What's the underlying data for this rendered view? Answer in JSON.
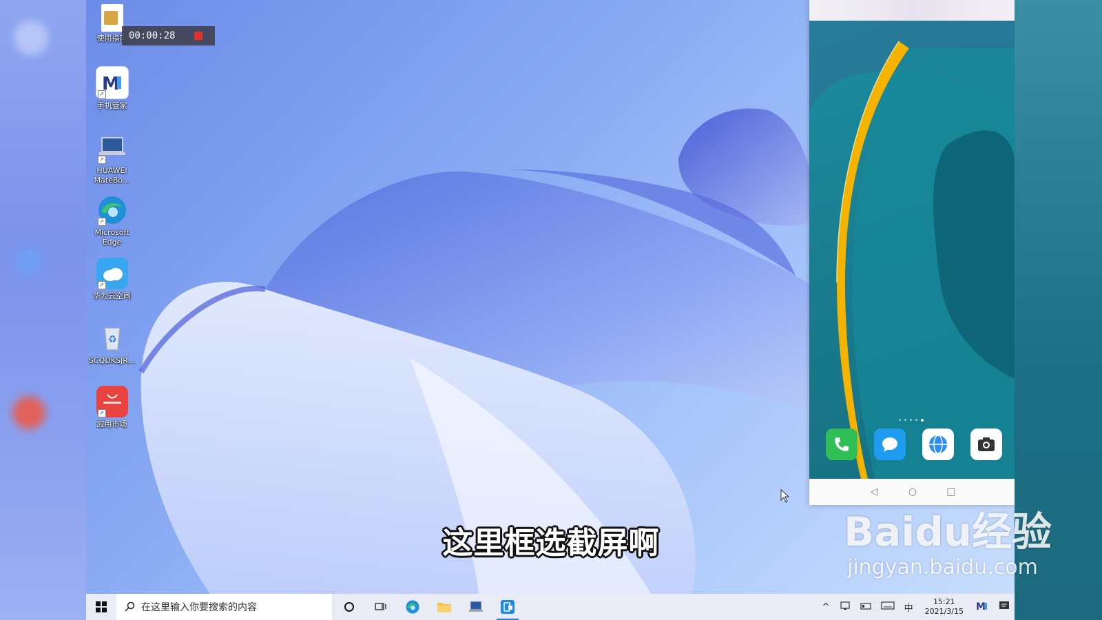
{
  "recorder": {
    "time": "00:00:28"
  },
  "desktop_icons": [
    {
      "label": "使用指南"
    },
    {
      "label": "手机管家"
    },
    {
      "label": "HUAWEI MateBo..."
    },
    {
      "label": "Microsoft Edge"
    },
    {
      "label": "华为云空间"
    },
    {
      "label": "SCQDKSJR..."
    },
    {
      "label": "应用市场"
    }
  ],
  "subtitle": "这里框选截屏啊",
  "watermark": {
    "brand": "Baidu经验",
    "url": "jingyan.baidu.com"
  },
  "taskbar": {
    "search_placeholder": "在这里输入你要搜索的内容",
    "tray": {
      "chevron": "^",
      "ime": "中",
      "time": "15:21",
      "date": "2021/3/15"
    }
  },
  "phone": {
    "dock": [
      "phone-app",
      "messages-app",
      "browser-app",
      "camera-app"
    ],
    "nav": {
      "back": "◁",
      "home": "○",
      "recents": "□"
    }
  },
  "colors": {
    "accent": "#2c7fd8",
    "recorder_stop": "#e03232",
    "huawei_red": "#e8433f"
  }
}
